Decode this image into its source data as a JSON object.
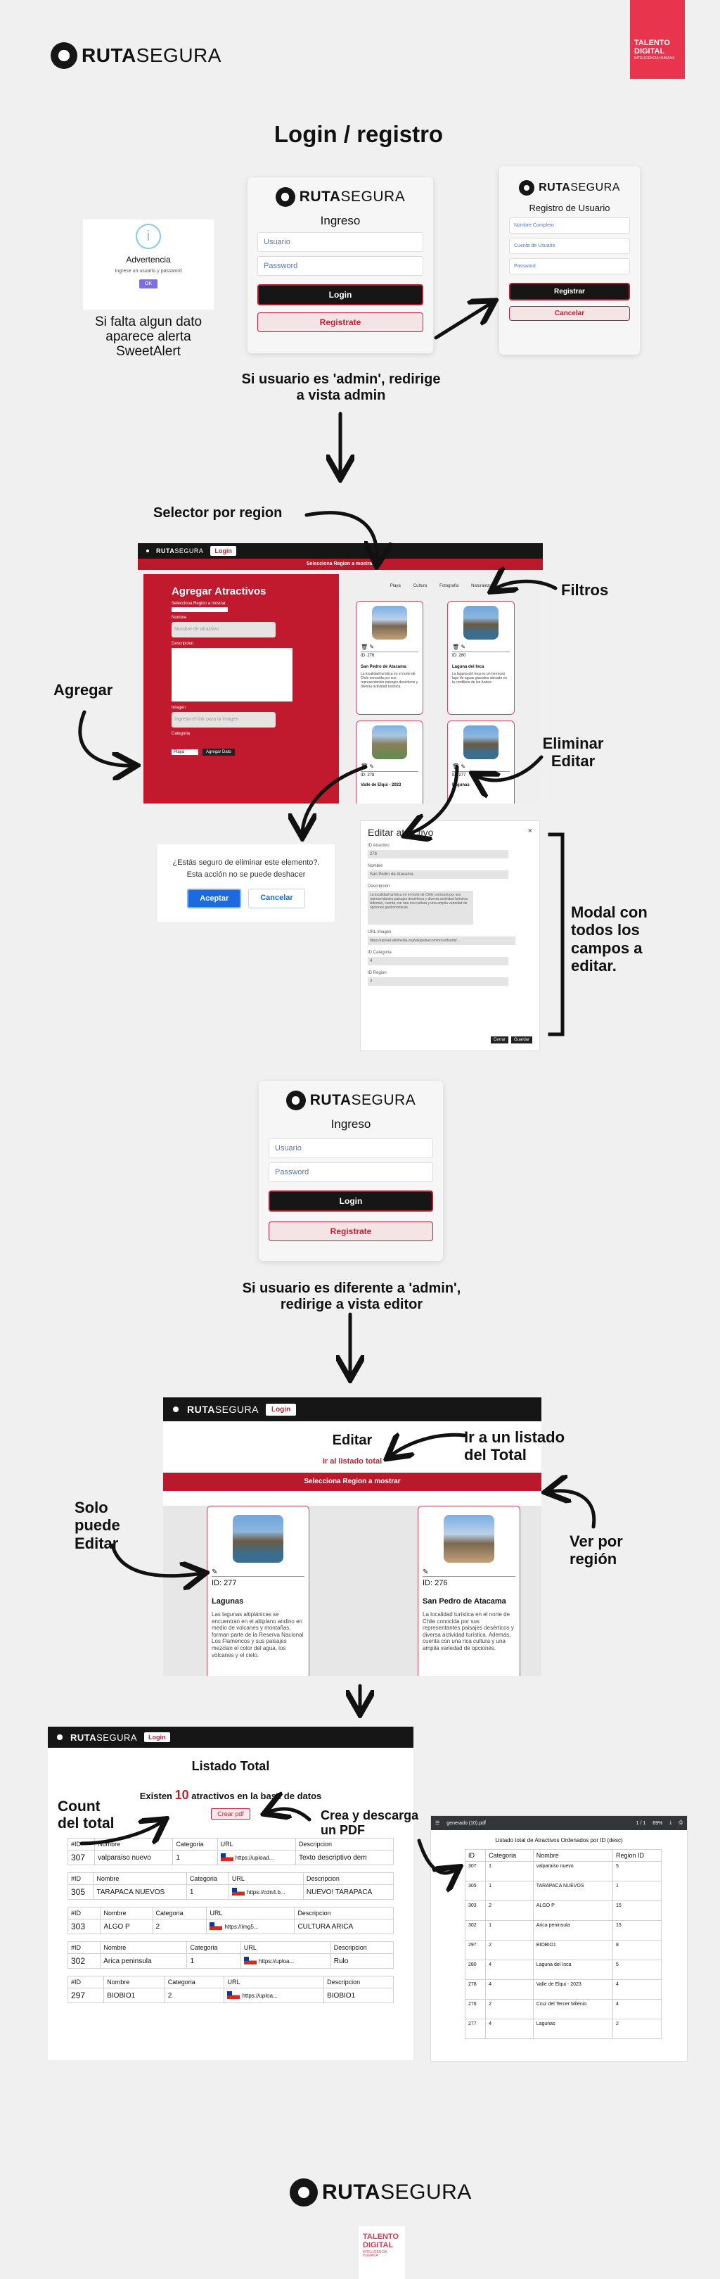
{
  "brand": {
    "bold": "RUTA",
    "light": "SEGURA"
  },
  "talento": {
    "l1": "TALENTO",
    "l2": "DIGITAL",
    "small": "INTELIGENCIA HUMANA"
  },
  "section1": {
    "title_a": "Login",
    "sep": "/",
    "title_b": "registro"
  },
  "alert": {
    "title": "Advertencia",
    "text": "Ingrese un usuario y password",
    "ok": "OK",
    "icon": "i"
  },
  "alert_note": "Si falta algun dato aparece alerta SweetAlert",
  "login": {
    "title": "Ingreso",
    "user_ph": "Usuario",
    "pass_ph": "Password",
    "login_btn": "Login",
    "register_btn": "Registrate"
  },
  "register": {
    "title": "Registro de Usuario",
    "f1": "Nombre Completo",
    "f2": "Cuenta de Usuario",
    "f3": "Password",
    "btn": "Registrar",
    "cancel": "Cancelar"
  },
  "admin_note": "Si usuario es 'admin', redirige a vista admin",
  "ann_region": "Selector por region",
  "ann_filtros": "Filtros",
  "ann_agregar": "Agregar",
  "ann_eliminar": "Eliminar Editar",
  "admin": {
    "nav_login": "Login",
    "redbar": "Selecciona Region a mostrar",
    "form_title": "Agregar Atractivos",
    "f_region": "Selecciona Region a mostrar",
    "f_nombre": "Nombre",
    "f_nombre_ph": "Nombre de atractivo",
    "f_desc": "Descripcion",
    "f_url": "Imagen",
    "f_url_ph": "Ingresa el link para la imagen",
    "f_cat": "Categoria",
    "f_cat_val": "Playa",
    "f_btn": "Agregar Dato",
    "filters": [
      "Playa",
      "Cultura",
      "Fotografia",
      "Naturaleza"
    ],
    "cards": [
      {
        "id": "ID: 276",
        "name": "San Pedro de Atacama",
        "text": "La localidad turística en el norte de Chile conocida por sus representantes paisajes desérticos y diversa actividad turística."
      },
      {
        "id": "ID: 280",
        "name": "Laguna del Inca",
        "text": "La laguna del Inca es un hermoso lago de aguas glaciales ubicado en la cordillera de los Andes."
      },
      {
        "id": "ID: 278",
        "name": "Valle de Elqui - 2023",
        "text": ""
      },
      {
        "id": "ID: 277",
        "name": "Lagunas",
        "text": ""
      }
    ]
  },
  "confirm": {
    "text": "¿Estás seguro de eliminar este elemento?. Esta acción no se puede deshacer",
    "ok": "Aceptar",
    "cancel": "Cancelar"
  },
  "modal": {
    "title": "Editar atractivo",
    "close": "×",
    "l1": "ID Atractivo",
    "v1": "276",
    "l2": "Nombre",
    "v2": "San Pedro de Atacama",
    "l3": "Descripción",
    "v3": "La localidad turística en el norte de Chile conocida por sus representantes paisajes desérticos y diversa actividad turística. Además, cuenta con una rica cultura y una amplia variedad de opciones gastronómicas.",
    "l4": "URL Imagen",
    "v4": "https://upload.wikimedia.org/wikipedia/commons/thumb/...",
    "l5": "ID Categoria",
    "v5": "4",
    "l6": "ID Region",
    "v6": "2",
    "btn_close": "Cerrar",
    "btn_save": "Guardar"
  },
  "modal_note": "Modal con todos los campos a editar.",
  "editor_note": "Si usuario es diferente a 'admin', redirige a vista editor",
  "editor": {
    "nav_login": "Login",
    "title": "Editar",
    "link": "Ir al listado total",
    "redbar": "Selecciona Region a mostrar",
    "cards": [
      {
        "id": "ID: 277",
        "name": "Lagunas",
        "text": "Las lagunas altiplánicas se encuentran en el altiplano andino en medio de volcanes y montañas, forman parte de la Reserva Nacional Los Flamencos y sus paisajes mezclan el color del agua, los volcanes y el cielo."
      },
      {
        "id": "ID: 276",
        "name": "San Pedro de Atacama",
        "text": "La localidad turística en el norte de Chile conocida por sus representantes paisajes desérticos y diversa actividad turística. Además, cuenta con una rica cultura y una amplia variedad de opciones."
      }
    ]
  },
  "ann_solo": "Solo puede Editar",
  "ann_listado": "Ir a un listado del Total",
  "ann_ver": "Ver por región",
  "listado": {
    "nav_login": "Login",
    "title": "Listado Total",
    "count_pre": "Existen",
    "count": "10",
    "count_post": "atractivos en la base de datos",
    "pdf_btn": "Crear pdf",
    "headers": [
      "#ID",
      "Nombre",
      "Categoria",
      "URL",
      "Descripcion"
    ],
    "rows": [
      {
        "id": "307",
        "name": "valparaiso nuevo",
        "cat": "1",
        "url": "https://upload...",
        "desc": "Texto descriptivo dem"
      },
      {
        "id": "305",
        "name": "TARAPACA NUEVOS",
        "cat": "1",
        "url": "https://cdn4.b...",
        "desc": "NUEVO! TARAPACA"
      },
      {
        "id": "303",
        "name": "ALGO P",
        "cat": "2",
        "url": "https://img5...",
        "desc": "CULTURA ARICA"
      },
      {
        "id": "302",
        "name": "Arica peninsula",
        "cat": "1",
        "url": "https://uploa...",
        "desc": "Rulo"
      },
      {
        "id": "297",
        "name": "BIOBIO1",
        "cat": "2",
        "url": "https://uploa...",
        "desc": "BIOBIO1"
      }
    ]
  },
  "ann_count": "Count del total",
  "ann_pdf": "Crea y descarga un PDF",
  "pdf": {
    "file": "generado (10).pdf",
    "page": "1 / 1",
    "zoom": "69%",
    "title": "Listado total de Atractivos Ordenados por ID (desc)",
    "headers": [
      "ID",
      "Categoria",
      "Nombre",
      "Region ID"
    ],
    "rows": [
      [
        "307",
        "1",
        "valparaiso nuevo",
        "5"
      ],
      [
        "305",
        "1",
        "TARAPACA NUEVOS",
        "1"
      ],
      [
        "303",
        "2",
        "ALGO P",
        "15"
      ],
      [
        "302",
        "1",
        "Arica peninsula",
        "15"
      ],
      [
        "297",
        "2",
        "BIOBIO1",
        "8"
      ],
      [
        "280",
        "4",
        "Laguna del Inca",
        "5"
      ],
      [
        "278",
        "4",
        "Valle de Elqui - 2023",
        "4"
      ],
      [
        "276",
        "2",
        "Cruz del Tercer Milenio",
        "4"
      ],
      [
        "277",
        "4",
        "Lagunas",
        "2"
      ]
    ]
  }
}
